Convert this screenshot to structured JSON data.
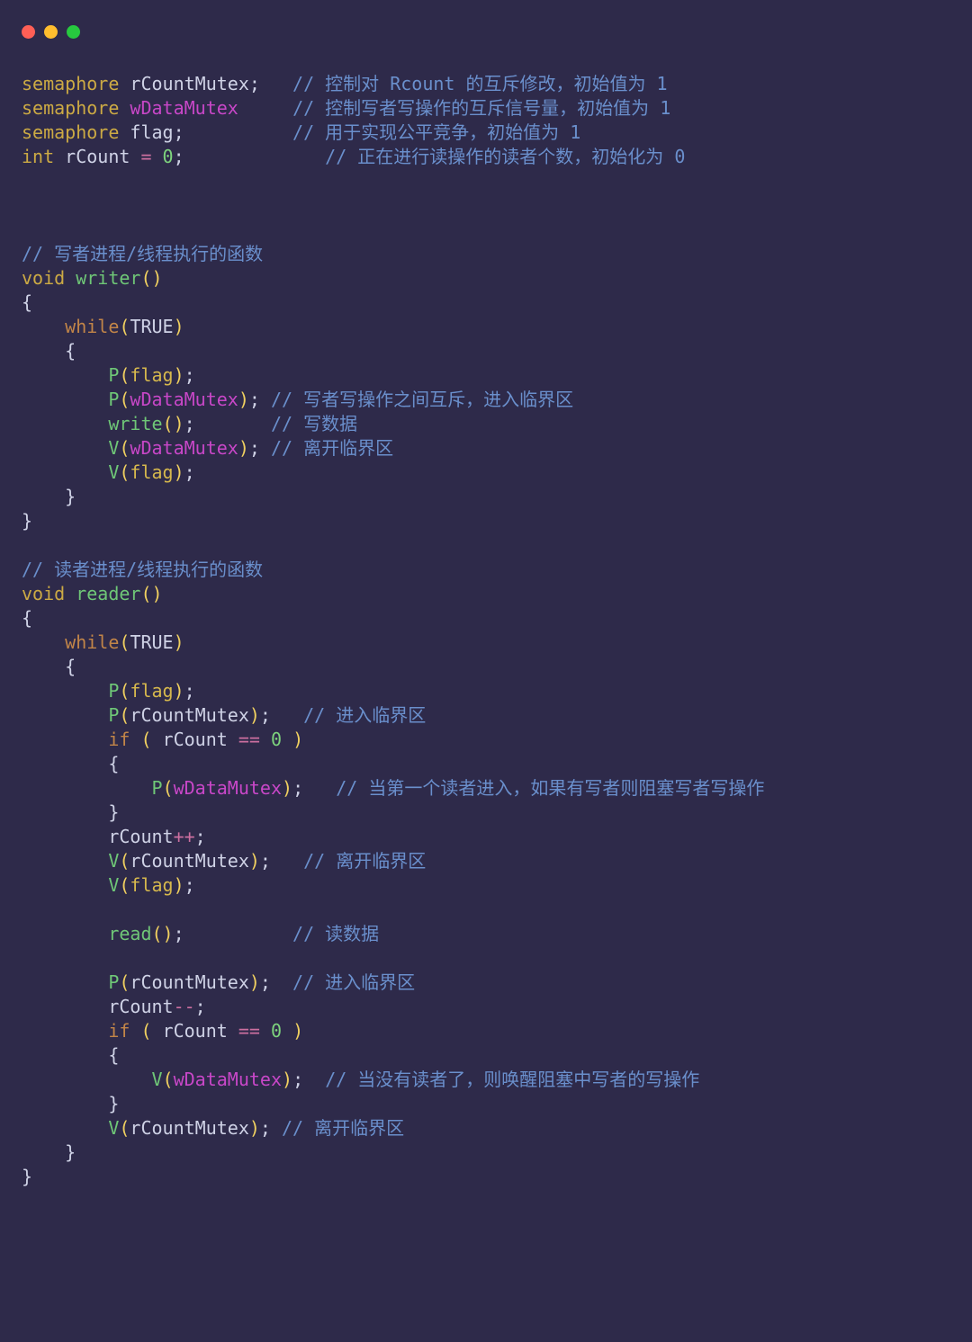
{
  "title_bar": {
    "dot_red": "close",
    "dot_yellow": "minimize",
    "dot_green": "zoom"
  },
  "code": {
    "l1": {
      "t1": "semaphore",
      "t2": " rCountMutex;   ",
      "c": "// 控制对 Rcount 的互斥修改，初始值为 1"
    },
    "l2": {
      "t1": "semaphore",
      "sp": " ",
      "t2": "wDataMutex",
      "pad": "     ",
      "c": "// 控制写者写操作的互斥信号量，初始值为 1"
    },
    "l3": {
      "t1": "semaphore",
      "t2": " flag;          ",
      "c": "// 用于实现公平竞争，初始值为 1"
    },
    "l4": {
      "t1": "int",
      "t2": " rCount ",
      "op": "=",
      "sp": " ",
      "n": "0",
      "t3": ";             ",
      "c": "// 正在进行读操作的读者个数，初始化为 0"
    },
    "l8": {
      "c": "// 写者进程/线程执行的函数"
    },
    "l9": {
      "t1": "void",
      "sp": " ",
      "fn": "writer",
      "p": "()"
    },
    "l10": {
      "t": "{"
    },
    "l11": {
      "ind": "    ",
      "kw": "while",
      "p1": "(",
      "tr": "TRUE",
      "p2": ")"
    },
    "l12": {
      "ind": "    ",
      "t": "{"
    },
    "l13": {
      "ind": "        ",
      "fn": "P",
      "p1": "(",
      "arg": "flag",
      "p2": ")",
      "t": ";"
    },
    "l14": {
      "ind": "        ",
      "fn": "P",
      "p1": "(",
      "arg": "wDataMutex",
      "p2": ")",
      "t": "; ",
      "c": "// 写者写操作之间互斥，进入临界区"
    },
    "l15": {
      "ind": "        ",
      "fn": "write",
      "p": "()",
      "t": ";       ",
      "c": "// 写数据"
    },
    "l16": {
      "ind": "        ",
      "fn": "V",
      "p1": "(",
      "arg": "wDataMutex",
      "p2": ")",
      "t": "; ",
      "c": "// 离开临界区"
    },
    "l17": {
      "ind": "        ",
      "fn": "V",
      "p1": "(",
      "arg": "flag",
      "p2": ")",
      "t": ";"
    },
    "l18": {
      "ind": "    ",
      "t": "}"
    },
    "l19": {
      "t": "}"
    },
    "l21": {
      "c": "// 读者进程/线程执行的函数"
    },
    "l22": {
      "t1": "void",
      "sp": " ",
      "fn": "reader",
      "p": "()"
    },
    "l23": {
      "t": "{"
    },
    "l24": {
      "ind": "    ",
      "kw": "while",
      "p1": "(",
      "tr": "TRUE",
      "p2": ")"
    },
    "l25": {
      "ind": "    ",
      "t": "{"
    },
    "l26": {
      "ind": "        ",
      "fn": "P",
      "p1": "(",
      "arg": "flag",
      "p2": ")",
      "t": ";"
    },
    "l27": {
      "ind": "        ",
      "fn": "P",
      "p1": "(",
      "arg": "rCountMutex",
      "p2": ")",
      "t": ";   ",
      "c": "// 进入临界区"
    },
    "l28": {
      "ind": "        ",
      "kw": "if",
      "sp": " ",
      "p1": "(",
      "t1": " rCount ",
      "op": "==",
      "sp2": " ",
      "n": "0",
      "sp3": " ",
      "p2": ")"
    },
    "l29": {
      "ind": "        ",
      "t": "{"
    },
    "l30": {
      "ind": "            ",
      "fn": "P",
      "p1": "(",
      "arg": "wDataMutex",
      "p2": ")",
      "t": ";   ",
      "c": "// 当第一个读者进入，如果有写者则阻塞写者写操作"
    },
    "l31": {
      "ind": "        ",
      "t": "}"
    },
    "l32": {
      "ind": "        ",
      "t1": "rCount",
      "op": "++",
      "t2": ";"
    },
    "l33": {
      "ind": "        ",
      "fn": "V",
      "p1": "(",
      "arg": "rCountMutex",
      "p2": ")",
      "t": ";   ",
      "c": "// 离开临界区"
    },
    "l34": {
      "ind": "        ",
      "fn": "V",
      "p1": "(",
      "arg": "flag",
      "p2": ")",
      "t": ";"
    },
    "l36": {
      "ind": "        ",
      "fn": "read",
      "p": "()",
      "t": ";          ",
      "c": "// 读数据"
    },
    "l38": {
      "ind": "        ",
      "fn": "P",
      "p1": "(",
      "arg": "rCountMutex",
      "p2": ")",
      "t": ";  ",
      "c": "// 进入临界区"
    },
    "l39": {
      "ind": "        ",
      "t1": "rCount",
      "op": "--",
      "t2": ";"
    },
    "l40": {
      "ind": "        ",
      "kw": "if",
      "sp": " ",
      "p1": "(",
      "t1": " rCount ",
      "op": "==",
      "sp2": " ",
      "n": "0",
      "sp3": " ",
      "p2": ")"
    },
    "l41": {
      "ind": "        ",
      "t": "{"
    },
    "l42": {
      "ind": "            ",
      "fn": "V",
      "p1": "(",
      "arg": "wDataMutex",
      "p2": ")",
      "t": ";  ",
      "c": "// 当没有读者了，则唤醒阻塞中写者的写操作"
    },
    "l43": {
      "ind": "        ",
      "t": "}"
    },
    "l44": {
      "ind": "        ",
      "fn": "V",
      "p1": "(",
      "arg": "rCountMutex",
      "p2": ")",
      "t": "; ",
      "c": "// 离开临界区"
    },
    "l45": {
      "ind": "    ",
      "t": "}"
    },
    "l46": {
      "t": "}"
    }
  }
}
